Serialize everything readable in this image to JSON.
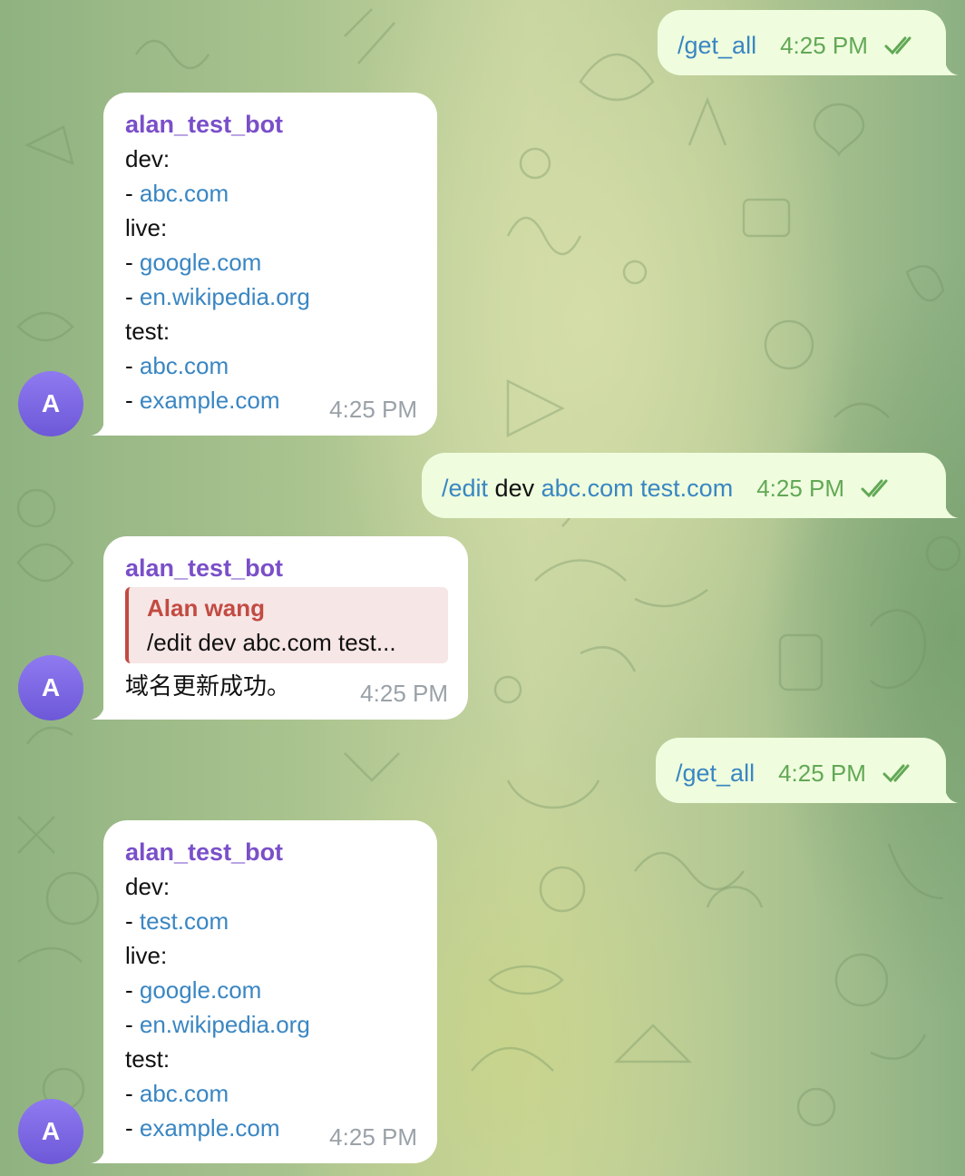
{
  "sender_name": "alan_test_bot",
  "avatar_letter": "A",
  "accent": {
    "sender": "#7a4fc9",
    "link": "#3a86c2",
    "quote": "#c24b42",
    "outgoing_bubble": "#effdde",
    "read_check": "#62a856"
  },
  "messages": [
    {
      "dir": "out",
      "command": "/get_all",
      "time": "4:25 PM",
      "status_icon": "double-check-icon"
    },
    {
      "dir": "in",
      "sender": "alan_test_bot",
      "lines": [
        {
          "text": "dev:"
        },
        {
          "prefix": "- ",
          "link": "abc.com"
        },
        {
          "text": "live:"
        },
        {
          "prefix": "- ",
          "link": "google.com"
        },
        {
          "prefix": "- ",
          "link": "en.wikipedia.org"
        },
        {
          "text": "test:"
        },
        {
          "prefix": "- ",
          "link": "abc.com"
        },
        {
          "prefix": "- ",
          "link": "example.com"
        }
      ],
      "time": "4:25 PM"
    },
    {
      "dir": "out",
      "command": "/edit",
      "plain": " dev ",
      "link1": "abc.com",
      "link2": "test.com",
      "time": "4:25 PM",
      "status_icon": "double-check-icon"
    },
    {
      "dir": "in",
      "sender": "alan_test_bot",
      "reply_to": {
        "author": "Alan wang",
        "text": "/edit dev abc.com test..."
      },
      "text": "域名更新成功。",
      "time": "4:25 PM"
    },
    {
      "dir": "out",
      "command": "/get_all",
      "time": "4:25 PM",
      "status_icon": "double-check-icon"
    },
    {
      "dir": "in",
      "sender": "alan_test_bot",
      "lines": [
        {
          "text": "dev:"
        },
        {
          "prefix": "- ",
          "link": "test.com"
        },
        {
          "text": "live:"
        },
        {
          "prefix": "- ",
          "link": "google.com"
        },
        {
          "prefix": "- ",
          "link": "en.wikipedia.org"
        },
        {
          "text": "test:"
        },
        {
          "prefix": "- ",
          "link": "abc.com"
        },
        {
          "prefix": "- ",
          "link": "example.com"
        }
      ],
      "time": "4:25 PM"
    }
  ]
}
